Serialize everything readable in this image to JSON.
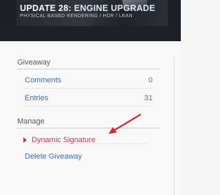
{
  "banner": {
    "title_prefix": "UPDATE 28: ",
    "title_accent": "ENGINE UPGRADE",
    "subtitle": "PHYSICAL BASED RENDERING / HDR / LEAN"
  },
  "giveaway_section": {
    "heading": "Giveaway",
    "items": [
      {
        "label": "Comments",
        "count": "0"
      },
      {
        "label": "Entries",
        "count": "31"
      }
    ]
  },
  "manage_section": {
    "heading": "Manage",
    "items": [
      {
        "label": "Dynamic Signature"
      },
      {
        "label": "Delete Giveaway"
      }
    ]
  },
  "colors": {
    "link": "#3d6ea8",
    "active_link": "#c23c54",
    "annotation_arrow": "#e0242b"
  },
  "annotation": {
    "arrow_icon": "red-arrow-icon"
  }
}
